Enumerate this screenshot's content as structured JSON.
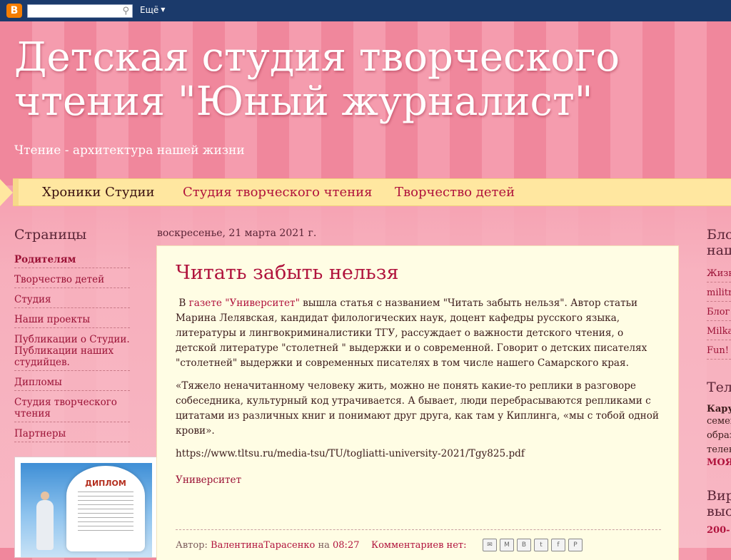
{
  "navbar": {
    "logo_letter": "B",
    "search_icon": "⚲",
    "more_label": "Ещё",
    "caret": "▼"
  },
  "header": {
    "title": "Детская студия творческого чтения \"Юный журналист\"",
    "description": "Чтение - архитектура нашей жизни"
  },
  "tabs": [
    {
      "label": "Хроники Студии"
    },
    {
      "label": "Студия творческого чтения"
    },
    {
      "label": "Творчество детей"
    }
  ],
  "sidebar_left": {
    "heading": "Страницы",
    "pages": [
      {
        "label": "Родителям"
      },
      {
        "label": "Творчество детей"
      },
      {
        "label": "Студия"
      },
      {
        "label": "Наши проекты"
      },
      {
        "label": "Публикации о Студии. Публикации наших студийцев."
      },
      {
        "label": "Дипломы"
      },
      {
        "label": "Студия творческого чтения"
      },
      {
        "label": "Партнеры"
      }
    ],
    "diploma_label": "ДИПЛОМ"
  },
  "post": {
    "date": "воскресенье, 21 марта 2021 г.",
    "title": "Читать забыть нельзя",
    "p1_prefix": "В ",
    "p1_link": "газете \"Университет\"",
    "p1_text": " вышла статья с названием \"Читать забыть нельзя\". Автор статьи Марина Лелявская, кандидат филологических наук, доцент кафедры русского языка, литературы и лингвокриминалистики ТГУ, рассуждает о важности детского чтения, о детской литературе \"столетней \" выдержки и о современной. Говорит о детских писателях \"столетней\" выдержки и современных писателях в том числе  нашего Самарского края.",
    "p2": "«Тяжело неначитанному человеку жить, можно не понять какие-то реплики в разговоре собеседника, культурный код утрачивается. А бывает, люди перебрасываются репликами с цитатами из различных книг и понимают друг друга, как там у Киплинга, «мы с тобой одной крови».",
    "url": "https://www.tltsu.ru/media-tsu/TU/togliatti-university-2021/Tgy825.pdf",
    "label": "Университет",
    "footer_author_prefix": "Автор:",
    "footer_author": "ВалентинаТарасенко",
    "footer_time_prefix": "на",
    "footer_time": "08:27",
    "footer_comments": "Комментариев нет:",
    "share": [
      "✉",
      "M",
      "B",
      "t",
      "f",
      "P"
    ]
  },
  "sidebar_right": {
    "heading_1": "Блог",
    "heading_1b": "наш",
    "blog_items": [
      {
        "label": "Жизн"
      },
      {
        "label": "militr"
      },
      {
        "label": "Блог"
      },
      {
        "label": "Milka"
      },
      {
        "label": "Fun!"
      }
    ],
    "heading_2": "Тел",
    "tv_bold": "Кару",
    "tv_lines": [
      "семей",
      "образ",
      "телек"
    ],
    "tv_bold_red": "МОЯ",
    "heading_3": "Вир",
    "heading_3b": "выс",
    "v_bold_red": "200-"
  }
}
